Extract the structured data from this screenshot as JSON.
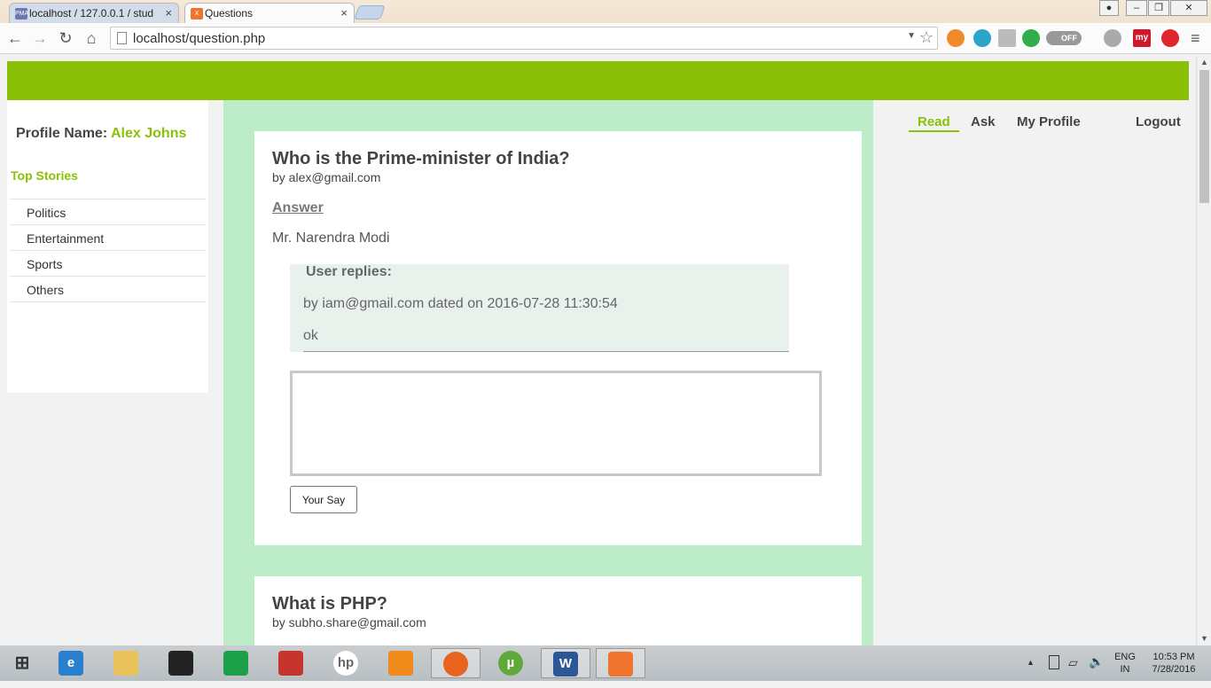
{
  "browser": {
    "tabs": [
      {
        "label": "localhost / 127.0.0.1 / stud",
        "icon": "phpmyadmin-icon",
        "icon_label": "PMA"
      },
      {
        "label": "Questions",
        "icon": "xampp-icon",
        "icon_label": "X"
      }
    ],
    "close_glyph": "×",
    "url": "localhost/question.php",
    "toggle_label": "OFF",
    "ext_my_label": "my"
  },
  "sidebar": {
    "profile_label": "Profile Name:",
    "profile_name": "Alex Johns",
    "top_stories": "Top Stories",
    "categories": [
      "Politics",
      "Entertainment",
      "Sports",
      "Others"
    ]
  },
  "nav": {
    "read": "Read",
    "ask": "Ask",
    "my_profile": "My Profile",
    "logout": "Logout"
  },
  "questions": [
    {
      "title": "Who is the Prime-minister of India?",
      "by": "by alex@gmail.com",
      "answer_label": "Answer",
      "answer": "Mr. Narendra Modi",
      "replies_title": "User replies:",
      "replies": [
        {
          "meta": "by iam@gmail.com dated on 2016-07-28 11:30:54",
          "text": "ok"
        }
      ],
      "reply_button": "Your Say"
    },
    {
      "title": "What is PHP?",
      "by": "by subho.share@gmail.com"
    }
  ],
  "taskbar": {
    "tray_lang": "ENG",
    "tray_region": "IN",
    "time": "10:53 PM",
    "date": "7/28/2016"
  },
  "colors": {
    "accent": "#8ac007",
    "main_bg": "#bcecc8",
    "reply_bg": "#e9f1ec"
  }
}
